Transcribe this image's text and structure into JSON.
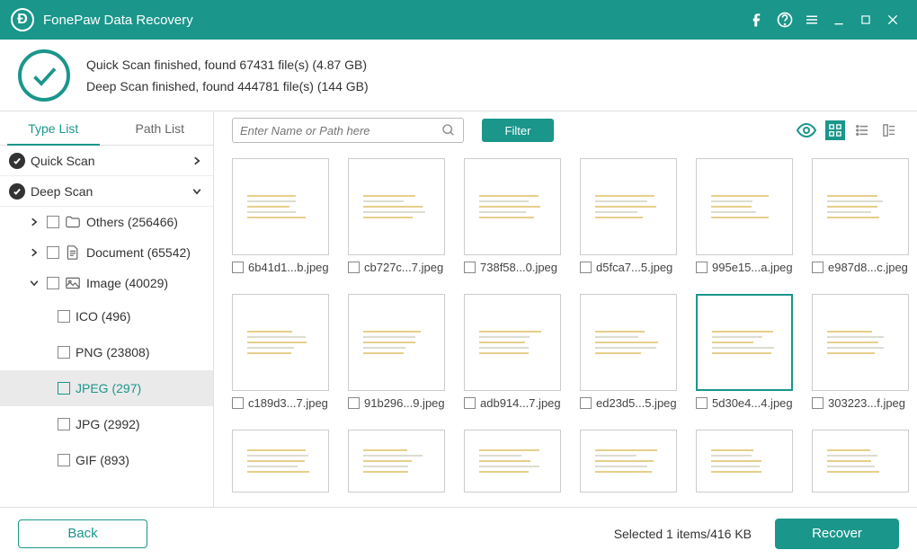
{
  "app_title": "FonePaw Data Recovery",
  "status": {
    "quick": "Quick Scan finished, found 67431 file(s) (4.87 GB)",
    "deep": "Deep Scan finished, found 444781 file(s) (144 GB)"
  },
  "sidebar": {
    "tabs": {
      "type_list": "Type List",
      "path_list": "Path List"
    },
    "quick_scan": "Quick Scan",
    "deep_scan": "Deep Scan",
    "cats": {
      "others": "Others (256466)",
      "document": "Document (65542)",
      "image": "Image (40029)"
    },
    "exts": {
      "ico": "ICO (496)",
      "png": "PNG (23808)",
      "jpeg": "JPEG (297)",
      "jpg": "JPG (2992)",
      "gif": "GIF (893)"
    }
  },
  "toolbar": {
    "search_placeholder": "Enter Name or Path here",
    "filter": "Filter"
  },
  "thumbs": {
    "r0": [
      "6b41d1...b.jpeg",
      "cb727c...7.jpeg",
      "738f58...0.jpeg",
      "d5fca7...5.jpeg",
      "995e15...a.jpeg",
      "e987d8...c.jpeg"
    ],
    "r1": [
      "c189d3...7.jpeg",
      "91b296...9.jpeg",
      "adb914...7.jpeg",
      "ed23d5...5.jpeg",
      "5d30e4...4.jpeg",
      "303223...f.jpeg"
    ]
  },
  "footer": {
    "back": "Back",
    "selection": "Selected 1 items/416 KB",
    "recover": "Recover"
  }
}
